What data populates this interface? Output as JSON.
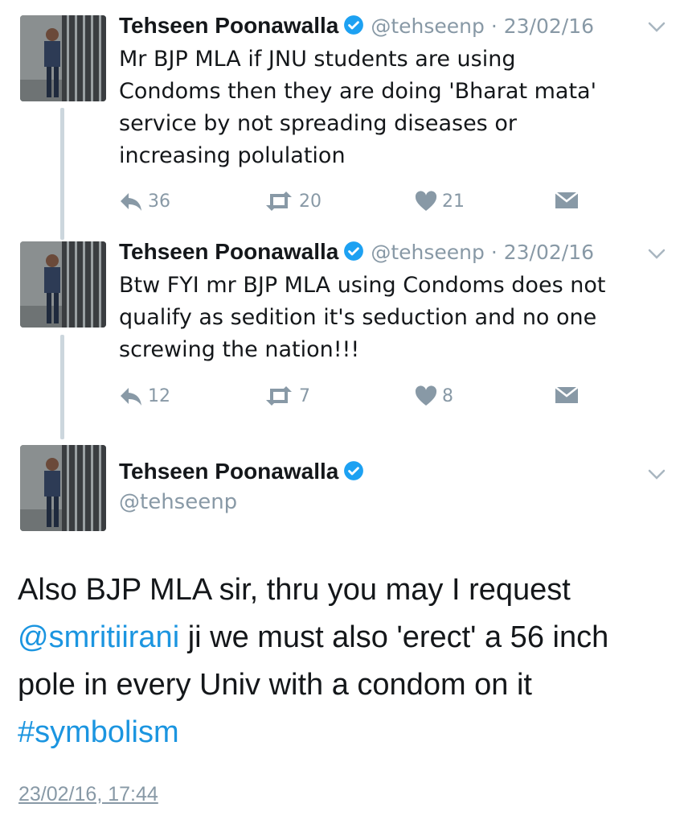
{
  "tweets": [
    {
      "name": "Tehseen Poonawalla",
      "handle": "@tehseenp",
      "date": "23/02/16",
      "text": "Mr BJP MLA if  JNU students are using\nCondoms then they are doing 'Bharat mata'\nservice by not spreading diseases or\nincreasing polulation",
      "replies": "36",
      "retweets": "20",
      "likes": "21"
    },
    {
      "name": "Tehseen Poonawalla",
      "handle": "@tehseenp",
      "date": "23/02/16",
      "text": "Btw FYI mr BJP MLA using Condoms does not\nqualify as sedition it's seduction and no one\nscrewing the nation!!!",
      "replies": "12",
      "retweets": "7",
      "likes": "8"
    }
  ],
  "main": {
    "name": "Tehseen Poonawalla",
    "handle": "@tehseenp",
    "text_line1": "Also BJP MLA sir, thru you may I request",
    "mention": "@smritiirani",
    "text_line2_rest": " ji we must also 'erect' a 56 inch",
    "text_line3": "pole in every Univ with a condom on it",
    "hashtag": "#symbolism",
    "timestamp": "23/02/16, 17:44"
  },
  "separator": " · ",
  "colors": {
    "link": "#1b95e0",
    "muted": "#8899a6",
    "verified": "#1da1f2"
  }
}
